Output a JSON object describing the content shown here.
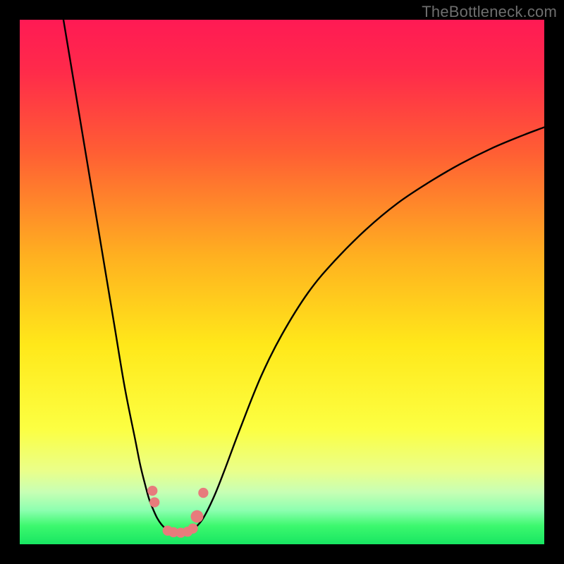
{
  "watermark": "TheBottleneck.com",
  "colors": {
    "bg_outer": "#000000",
    "gradient_stops": [
      {
        "offset": 0.0,
        "color": "#ff1a54"
      },
      {
        "offset": 0.1,
        "color": "#ff2b4a"
      },
      {
        "offset": 0.25,
        "color": "#ff5d34"
      },
      {
        "offset": 0.45,
        "color": "#ffb020"
      },
      {
        "offset": 0.62,
        "color": "#ffe81a"
      },
      {
        "offset": 0.78,
        "color": "#fcff42"
      },
      {
        "offset": 0.86,
        "color": "#eaff8a"
      },
      {
        "offset": 0.9,
        "color": "#c8ffb4"
      },
      {
        "offset": 0.935,
        "color": "#8dffb0"
      },
      {
        "offset": 0.965,
        "color": "#3cf86e"
      },
      {
        "offset": 1.0,
        "color": "#18e662"
      }
    ],
    "curve": "#000000",
    "marker_fill": "#e77b7c",
    "marker_stroke": "#e77b7c"
  },
  "chart_data": {
    "type": "line",
    "title": "",
    "xlabel": "",
    "ylabel": "",
    "xlim": [
      0,
      100
    ],
    "ylim": [
      0,
      100
    ],
    "series": [
      {
        "name": "left-branch",
        "x": [
          8,
          10,
          12,
          14,
          16,
          18,
          20,
          22,
          23,
          24,
          24.7,
          25.5,
          26.2,
          27,
          27.8,
          28.6
        ],
        "y": [
          102,
          90,
          78,
          66,
          54,
          42,
          30,
          20,
          15,
          11,
          8.5,
          6.5,
          5,
          3.8,
          3,
          2.5
        ]
      },
      {
        "name": "right-branch",
        "x": [
          32.5,
          33.5,
          35,
          37,
          39,
          42,
          46,
          50,
          55,
          60,
          66,
          72,
          78,
          84,
          90,
          96,
          100
        ],
        "y": [
          2.5,
          3.2,
          5,
          9,
          14,
          22,
          32,
          40,
          48,
          54,
          60,
          65,
          69,
          72.5,
          75.5,
          78,
          79.5
        ]
      },
      {
        "name": "valley-floor",
        "x": [
          28.6,
          29.4,
          30.2,
          31,
          31.8,
          32.5
        ],
        "y": [
          2.5,
          2.2,
          2.1,
          2.1,
          2.2,
          2.5
        ]
      }
    ],
    "markers": {
      "name": "highlighted-points",
      "x": [
        25.3,
        25.7,
        28.2,
        29.3,
        30.7,
        32.0,
        33.0,
        33.8,
        35.0
      ],
      "y": [
        10.2,
        8.0,
        2.6,
        2.3,
        2.2,
        2.4,
        3.0,
        5.3,
        9.8
      ],
      "r": [
        5.3,
        5.3,
        5.3,
        5.3,
        5.3,
        5.3,
        5.3,
        6.6,
        5.3
      ]
    }
  }
}
